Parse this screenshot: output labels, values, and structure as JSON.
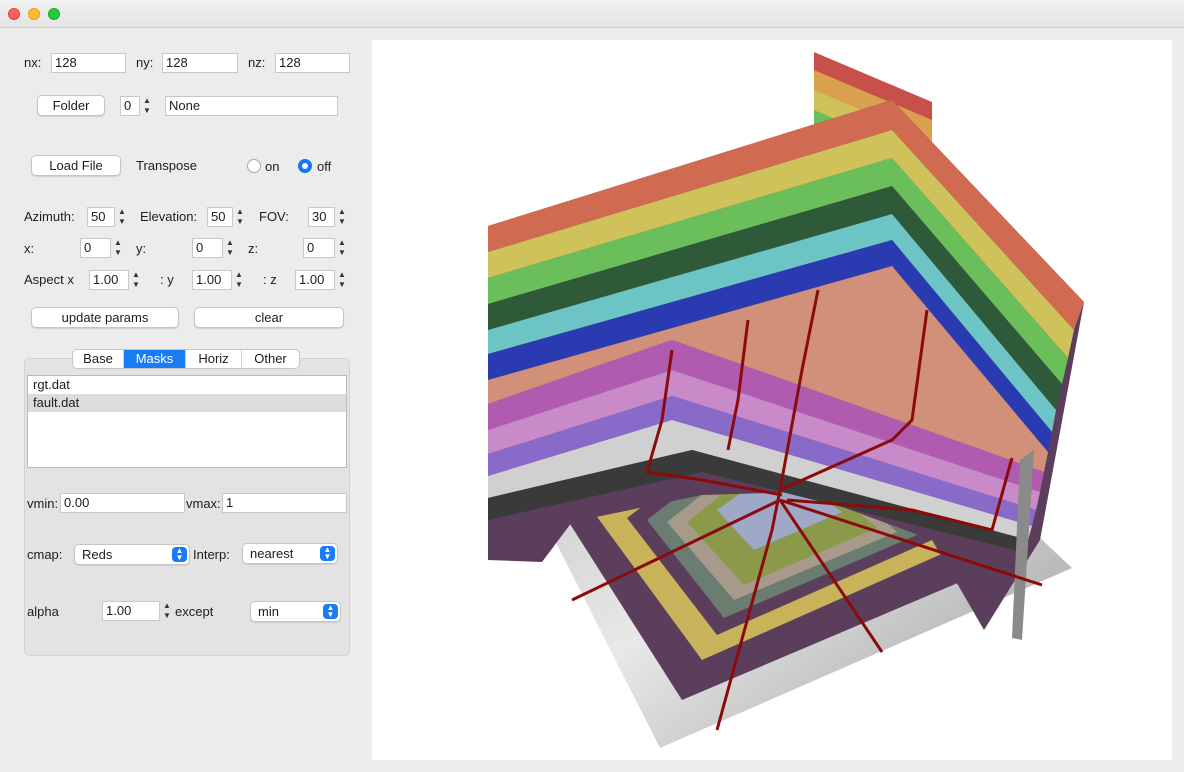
{
  "window": {
    "traffic_lights": [
      "close",
      "minimize",
      "maximize"
    ]
  },
  "dims": {
    "nx_label": "nx:",
    "nx_value": "128",
    "ny_label": "ny:",
    "ny_value": "128",
    "nz_label": "nz:",
    "nz_value": "128"
  },
  "folder": {
    "button_label": "Folder",
    "index_value": "0",
    "path_value": "None"
  },
  "file": {
    "load_label": "Load File",
    "transpose_label": "Transpose",
    "on_label": "on",
    "off_label": "off",
    "selected": "off"
  },
  "view": {
    "azimuth_label": "Azimuth:",
    "azimuth_value": "50",
    "elevation_label": "Elevation:",
    "elevation_value": "50",
    "fov_label": "FOV:",
    "fov_value": "30",
    "x_label": "x:",
    "x_value": "0",
    "y_label": "y:",
    "y_value": "0",
    "z_label": "z:",
    "z_value": "0",
    "aspect_x_label": "Aspect x",
    "aspect_x_value": "1.00",
    "aspect_y_label": ": y",
    "aspect_y_value": "1.00",
    "aspect_z_label": ": z",
    "aspect_z_value": "1.00"
  },
  "actions": {
    "update_label": "update params",
    "clear_label": "clear"
  },
  "tabs": [
    "Base",
    "Masks",
    "Horiz",
    "Other"
  ],
  "active_tab": "Masks",
  "masks": {
    "files": [
      "rgt.dat",
      "fault.dat"
    ],
    "selected": "fault.dat",
    "vmin_label": "vmin:",
    "vmin_value": "0.00",
    "vmax_label": "vmax:",
    "vmax_value": "1",
    "cmap_label": "cmap:",
    "cmap_value": "Reds",
    "interp_label": "Interp:",
    "interp_value": "nearest",
    "alpha_label": "alpha",
    "alpha_value": "1.00",
    "except_label": "except",
    "except_value": "min"
  },
  "colors": {
    "accent": "#1a7cf4",
    "fault": "#8b0a0a"
  }
}
